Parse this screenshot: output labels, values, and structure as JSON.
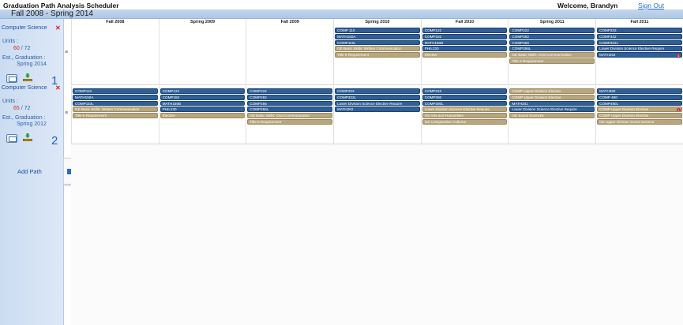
{
  "app": {
    "title": "Graduation Path Analysis Scheduler",
    "welcome": "Welcome, Brandyn",
    "sign_out": "Sign Out",
    "date_range": "Fall 2008 - Spring 2014"
  },
  "semesters": [
    "Fall 2008",
    "Spring 2009",
    "Fall 2009",
    "Spring 2010",
    "Fall 2010",
    "Spring 2011",
    "Fall 2011"
  ],
  "sidebar": {
    "add_path_label": "Add Path",
    "units_label": "Units :",
    "grad_label": "Est., Graduation :",
    "paths": [
      {
        "name": "Computer Science",
        "units_used": "60",
        "units_total": "/ 72",
        "graduation": "Spring 2014",
        "number": "1"
      },
      {
        "name": "Computer Science",
        "units_used": "65",
        "units_total": "/ 72",
        "graduation": "Spring 2012",
        "number": "2"
      }
    ]
  },
  "icons": {
    "close": "close-icon",
    "mail": "mail-icon",
    "download": "download-icon",
    "add": "plus-icon",
    "handle": "drag-handle-icon",
    "warning": "warning-badge-icon"
  },
  "colors": {
    "required_course": "#2f5f96",
    "ge_course": "#b7a67e",
    "accent": "#1c62c6",
    "warning": "#d42a2a"
  },
  "grid": {
    "paths": [
      {
        "cells": [
          [],
          [],
          [],
          [
            {
              "label": "COMP 110",
              "type": "req"
            },
            {
              "label": "MATH150A",
              "type": "req"
            },
            {
              "label": "COMP110L",
              "type": "req"
            },
            {
              "label": "GE Basic Skills: Written Communication",
              "type": "ge"
            },
            {
              "label": "Title 5 Requirement",
              "type": "ge"
            }
          ],
          [
            {
              "label": "COMP122",
              "type": "req"
            },
            {
              "label": "COMP182",
              "type": "req"
            },
            {
              "label": "MATH150B",
              "type": "req"
            },
            {
              "label": "PHIL230",
              "type": "req"
            },
            {
              "label": "Elective",
              "type": "ge"
            }
          ],
          [
            {
              "label": "COMP222",
              "type": "req"
            },
            {
              "label": "COMP282",
              "type": "req"
            },
            {
              "label": "COMP256",
              "type": "req"
            },
            {
              "label": "COMP256L",
              "type": "req"
            },
            {
              "label": "GE Basic Skills: Oral Communication",
              "type": "ge"
            },
            {
              "label": "Title 5 Requirement",
              "type": "ge"
            }
          ],
          [
            {
              "label": "COMP333",
              "type": "req"
            },
            {
              "label": "COMP322",
              "type": "req"
            },
            {
              "label": "COMP322L",
              "type": "req"
            },
            {
              "label": "Lower Division Science Elective Require",
              "type": "req"
            },
            {
              "label": "MATH262",
              "type": "req",
              "warning": "1"
            }
          ]
        ]
      },
      {
        "cells": [
          [
            {
              "label": "COMP110",
              "type": "req"
            },
            {
              "label": "MATH150A",
              "type": "req"
            },
            {
              "label": "COMP110L",
              "type": "req"
            },
            {
              "label": "GE Basic Skills: Written Communication",
              "type": "ge"
            },
            {
              "label": "Title 5 Requirement",
              "type": "ge"
            }
          ],
          [
            {
              "label": "COMP122",
              "type": "req"
            },
            {
              "label": "COMP182",
              "type": "req"
            },
            {
              "label": "MATH150B",
              "type": "req"
            },
            {
              "label": "PHIL230",
              "type": "req"
            },
            {
              "label": "Elective",
              "type": "ge"
            }
          ],
          [
            {
              "label": "COMP222",
              "type": "req"
            },
            {
              "label": "COMP282",
              "type": "req"
            },
            {
              "label": "COMP256",
              "type": "req"
            },
            {
              "label": "COMP256L",
              "type": "req"
            },
            {
              "label": "GE Basic Skills: Oral Communication",
              "type": "ge"
            },
            {
              "label": "Title 5 Requirement",
              "type": "ge"
            }
          ],
          [
            {
              "label": "COMP333",
              "type": "req"
            },
            {
              "label": "COMP322L",
              "type": "req"
            },
            {
              "label": "Lower Division Science Elective Require",
              "type": "req"
            },
            {
              "label": "MATH262",
              "type": "req"
            }
          ],
          [
            {
              "label": "COMP310",
              "type": "req"
            },
            {
              "label": "COMP380",
              "type": "req"
            },
            {
              "label": "COMP380L",
              "type": "req"
            },
            {
              "label": "Lower Division Science Elective Require",
              "type": "ge"
            },
            {
              "label": "GE Arts and Humanities",
              "type": "ge"
            },
            {
              "label": "GE Comparative Cultures",
              "type": "ge"
            }
          ],
          [
            {
              "label": "COMP Upper Division Elective",
              "type": "ge"
            },
            {
              "label": "COMP Upper Division Elective",
              "type": "ge"
            },
            {
              "label": "MATH341",
              "type": "req"
            },
            {
              "label": "Lower Division Science Elective Require",
              "type": "req"
            },
            {
              "label": "GE Social Sciences",
              "type": "ge"
            }
          ],
          [
            {
              "label": "MATH482",
              "type": "req"
            },
            {
              "label": "COMP 490",
              "type": "req"
            },
            {
              "label": "COMP490L",
              "type": "req"
            },
            {
              "label": "COMP Upper Division Elective",
              "type": "ge",
              "warning": "1"
            },
            {
              "label": "COMP Upper Division Elective",
              "type": "ge"
            },
            {
              "label": "GE Upper Division Social Science",
              "type": "ge"
            }
          ]
        ]
      }
    ]
  }
}
